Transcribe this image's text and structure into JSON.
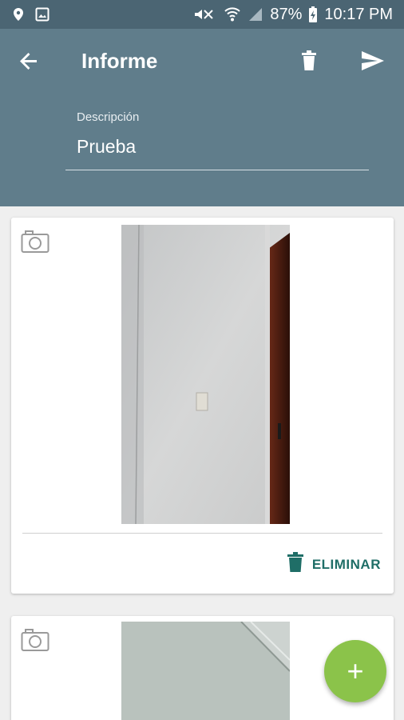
{
  "status_bar": {
    "battery": "87%",
    "time": "10:17 PM",
    "icons": [
      "location-icon",
      "image-icon",
      "mute-icon",
      "wifi-icon",
      "signal-icon",
      "battery-icon"
    ]
  },
  "app_bar": {
    "title": "Informe",
    "back_icon": "arrow-back-icon",
    "delete_icon": "trash-icon",
    "send_icon": "send-icon"
  },
  "description": {
    "label": "Descripción",
    "value": "Prueba"
  },
  "photos": [
    {
      "delete_label": "ELIMINAR"
    },
    {
      "delete_label": ""
    }
  ],
  "fab": {
    "label": "+"
  },
  "colors": {
    "status_bar": "#4b6573",
    "app_bar": "#607d8b",
    "accent": "#1f6e67",
    "fab": "#8bc34a"
  }
}
